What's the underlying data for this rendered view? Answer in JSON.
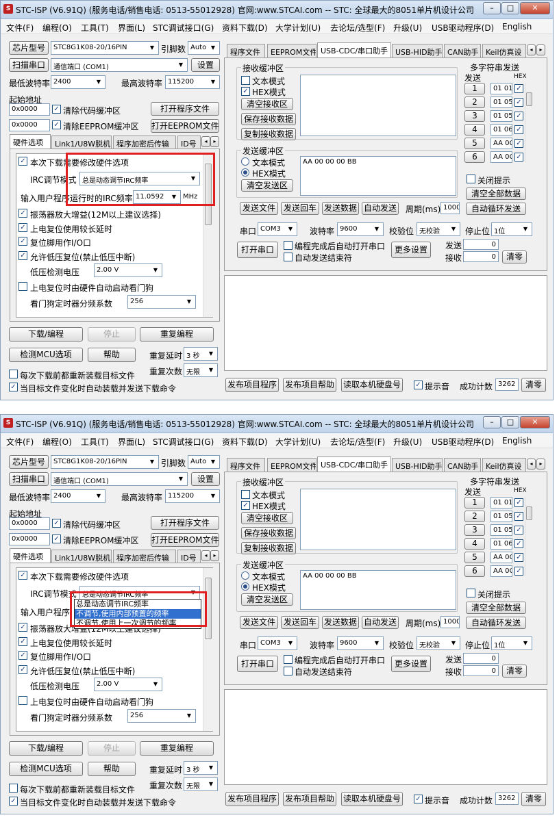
{
  "window": {
    "title": "STC-ISP (V6.91Q) (服务电话/销售电话: 0513-55012928) 官网:www.STCAI.com  -- STC: 全球最大的8051单片机设计公司 (...",
    "title_b": "STC-ISP (V6.91Q) (服务电话/销售电话: 0513-55012928) 官网:www.STCAI.com  -- STC: 全球最大的8051单片机设计公司 (..."
  },
  "menu": [
    "文件(F)",
    "编程(O)",
    "工具(T)",
    "界面(L)",
    "STC调试接口(G)",
    "资料下载(D)",
    "大学计划(U)",
    "去论坛/选型(F)",
    "升级(U)",
    "USB驱动程序(D)",
    "English"
  ],
  "left": {
    "chip_btn": "芯片型号",
    "chip_val": "STC8G1K08-20/16PIN",
    "pins_lbl": "引脚数",
    "pins_val": "Auto",
    "scan_btn": "扫描串口",
    "port_val": "通信端口 (COM1)",
    "settings_btn": "设置",
    "min_baud_lbl": "最低波特率",
    "min_baud_val": "2400",
    "max_baud_lbl": "最高波特率",
    "max_baud_val": "115200",
    "start_addr_lbl": "起始地址",
    "addr1": "0x0000",
    "clear_code": "清除代码缓冲区",
    "open_prog": "打开程序文件",
    "addr2": "0x0000",
    "clear_eeprom": "清除EEPROM缓冲区",
    "open_eeprom": "打开EEPROM文件"
  },
  "hw_tabs": [
    "硬件选项",
    "Link1/U8W脱机",
    "程序加密后传输",
    "ID号"
  ],
  "hw": {
    "modify": "本次下载需要修改硬件选项",
    "irc_mode_lbl": "IRC调节模式",
    "irc_mode_val": "总是动态调节IRC频率",
    "irc_freq_lbl": "输入用户程序运行时的IRC频率",
    "irc_freq_lbl_b": "输入用户程序",
    "irc_freq_val": "11.0592",
    "mhz": "MHz",
    "osc_gain": "振荡器放大增益(12M以上建议选择)",
    "long_delay": "上电复位使用较长延时",
    "reset_io": "复位脚用作I/O口",
    "lvr": "允许低压复位(禁止低压中断)",
    "lvd_lbl": "低压检测电压",
    "lvd_val": "2.00 V",
    "wdt": "上电复位时由硬件自动启动看门狗",
    "wdt_div_lbl": "看门狗定时器分频系数",
    "wdt_div_val": "256"
  },
  "irc_options": [
    "总是动态调节IRC频率",
    "不调节,使用内部预置的频率",
    "不调节,使用上一次调节的频率"
  ],
  "bottom_left": {
    "download": "下载/编程",
    "stop": "停止",
    "reprogram": "重复编程",
    "check_mcu": "检测MCU选项",
    "help": "帮助",
    "retry_delay_lbl": "重复延时",
    "retry_delay_val": "3 秒",
    "retry_count_lbl": "重复次数",
    "retry_count_val": "无限",
    "reload_each": "每次下载前都重新装载目标文件",
    "auto_send": "当目标文件变化时自动装载并发送下载命令"
  },
  "right_tabs": [
    "程序文件",
    "EEPROM文件",
    "USB-CDC/串口助手",
    "USB-HID助手",
    "CAN助手",
    "Keil仿真设"
  ],
  "serial": {
    "recv_group": "接收缓冲区",
    "text_mode": "文本模式",
    "hex_mode": "HEX模式",
    "clear_recv": "清空接收区",
    "save_recv": "保存接收数据",
    "copy_recv": "复制接收数据",
    "send_group": "发送缓冲区",
    "send_text": "AA 00 00 00 BB",
    "clear_send": "清空发送区",
    "send_file": "发送文件",
    "send_enter": "发送回车",
    "send_data": "发送数据",
    "auto_send": "自动发送",
    "period_lbl": "周期(ms)",
    "period_val": "1000",
    "port_lbl": "串口",
    "port_val": "COM3",
    "baud_lbl": "波特率",
    "baud_val": "9600",
    "parity_lbl": "校验位",
    "parity_val": "无校验",
    "stop_lbl": "停止位",
    "stop_val": "1位",
    "open_port": "打开串口",
    "auto_open": "编程完成后自动打开串口",
    "auto_end": "自动发送结束符",
    "more": "更多设置",
    "tx_lbl": "发送",
    "tx_val": "0",
    "rx_lbl": "接收",
    "rx_val": "0",
    "clear_cnt": "清零"
  },
  "multi": {
    "title": "多字符串发送",
    "send_lbl": "发送",
    "hex_lbl": "HEX",
    "rows": [
      {
        "n": "1",
        "v": "01 01"
      },
      {
        "n": "2",
        "v": "01 05"
      },
      {
        "n": "3",
        "v": "01 05"
      },
      {
        "n": "4",
        "v": "01 06"
      },
      {
        "n": "5",
        "v": "AA 0C"
      },
      {
        "n": "6",
        "v": "AA 0C"
      }
    ],
    "close_tip": "关闭提示",
    "clear_all": "清空全部数据",
    "auto_loop": "自动循环发送"
  },
  "footer": {
    "publish": "发布项目程序",
    "publish_help": "发布项目帮助",
    "read_disk": "读取本机硬盘号",
    "beep": "提示音",
    "count_lbl": "成功计数",
    "count_val": "3262",
    "clear": "清零"
  }
}
